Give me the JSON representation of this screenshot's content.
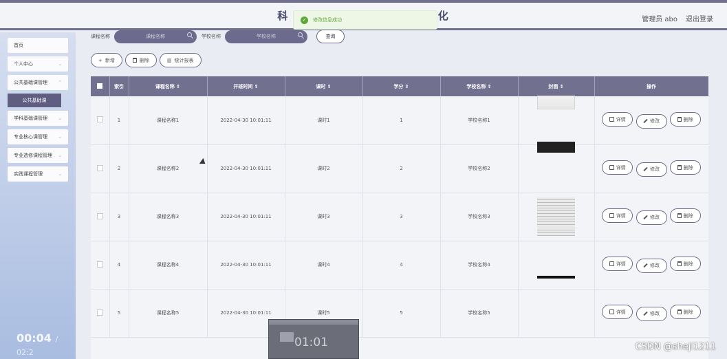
{
  "header": {
    "title_left": "科",
    "title_right": "化",
    "user_label": "管理员 abo",
    "logout_label": "退出登录"
  },
  "toast": {
    "message": "修改信息成功",
    "icon": "check-circle-icon"
  },
  "sidebar": {
    "items": [
      {
        "label": "首页"
      },
      {
        "label": "个人中心"
      },
      {
        "label": "公共基础课管理"
      },
      {
        "label": "学科基础课管理"
      },
      {
        "label": "专业核心课管理"
      },
      {
        "label": "专业选修课程管理"
      },
      {
        "label": "实践课程管理"
      }
    ],
    "active_sub": "公共基础课"
  },
  "video": {
    "time": "00:04",
    "total": "/ 02:2",
    "mini_time": "01:01"
  },
  "search": {
    "course_label": "课程名称",
    "course_placeholder": "课程名称",
    "school_label": "学校名称",
    "school_placeholder": "学校名称",
    "query_label": "查询"
  },
  "actions": {
    "add": "新增",
    "delete": "删除",
    "report": "统计报表"
  },
  "table": {
    "headers": [
      "索引",
      "课程名称",
      "开班时间",
      "课时",
      "学分",
      "学校名称",
      "封面",
      "操作"
    ],
    "rows": [
      {
        "index": "1",
        "course": "课程名称1",
        "time": "2022-04-30 10:01:11",
        "hours": "课时1",
        "credit": "1",
        "school": "学校名称1"
      },
      {
        "index": "2",
        "course": "课程名称2",
        "time": "2022-04-30 10:01:11",
        "hours": "课时2",
        "credit": "2",
        "school": "学校名称2"
      },
      {
        "index": "3",
        "course": "课程名称3",
        "time": "2022-04-30 10:01:11",
        "hours": "课时3",
        "credit": "3",
        "school": "学校名称3"
      },
      {
        "index": "4",
        "course": "课程名称4",
        "time": "2022-04-30 10:01:11",
        "hours": "课时4",
        "credit": "4",
        "school": "学校名称4"
      },
      {
        "index": "5",
        "course": "课程名称5",
        "time": "2022-04-30 10:01:11",
        "hours": "课时5",
        "credit": "5",
        "school": "学校名称5"
      }
    ],
    "ops": {
      "detail": "详情",
      "edit": "修改",
      "delete": "删除"
    }
  },
  "watermark": "CSDN @sheji1211"
}
